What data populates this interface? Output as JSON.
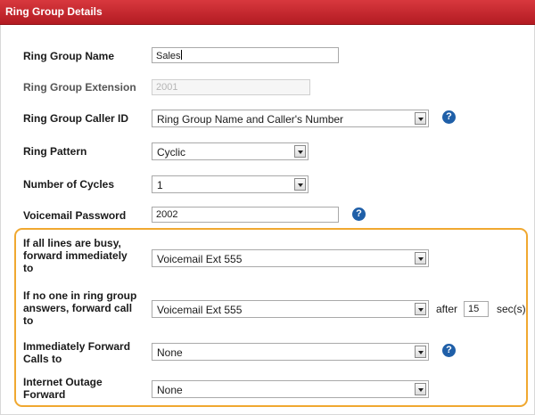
{
  "header": {
    "title": "Ring Group Details"
  },
  "fields": {
    "name": {
      "label": "Ring Group Name",
      "value": "Sales"
    },
    "extension": {
      "label": "Ring Group Extension",
      "value": "2001"
    },
    "caller_id": {
      "label": "Ring Group Caller ID",
      "value": "Ring Group Name and Caller's Number"
    },
    "ring_pattern": {
      "label": "Ring Pattern",
      "value": "Cyclic"
    },
    "cycles": {
      "label": "Number of Cycles",
      "value": "1"
    },
    "voicemail_password": {
      "label": "Voicemail Password",
      "value": "2002"
    }
  },
  "forwarding": {
    "busy": {
      "label_lines": [
        "If all lines are busy,",
        "forward immediately",
        "to"
      ],
      "value": "Voicemail Ext 555"
    },
    "no_answer": {
      "label_lines": [
        "If no one in ring group",
        "answers, forward call",
        "to"
      ],
      "value": "Voicemail Ext 555",
      "after_label": "after",
      "after_value": "15",
      "unit": "sec(s)"
    },
    "immediate": {
      "label_lines": [
        "Immediately Forward",
        "Calls to"
      ],
      "value": "None"
    },
    "outage": {
      "label_lines": [
        "Internet Outage",
        "Forward"
      ],
      "value": "None"
    }
  },
  "help_glyph": "?",
  "colors": {
    "header": "#c4262d",
    "highlight": "#f0a830",
    "help": "#1f5fa8"
  }
}
